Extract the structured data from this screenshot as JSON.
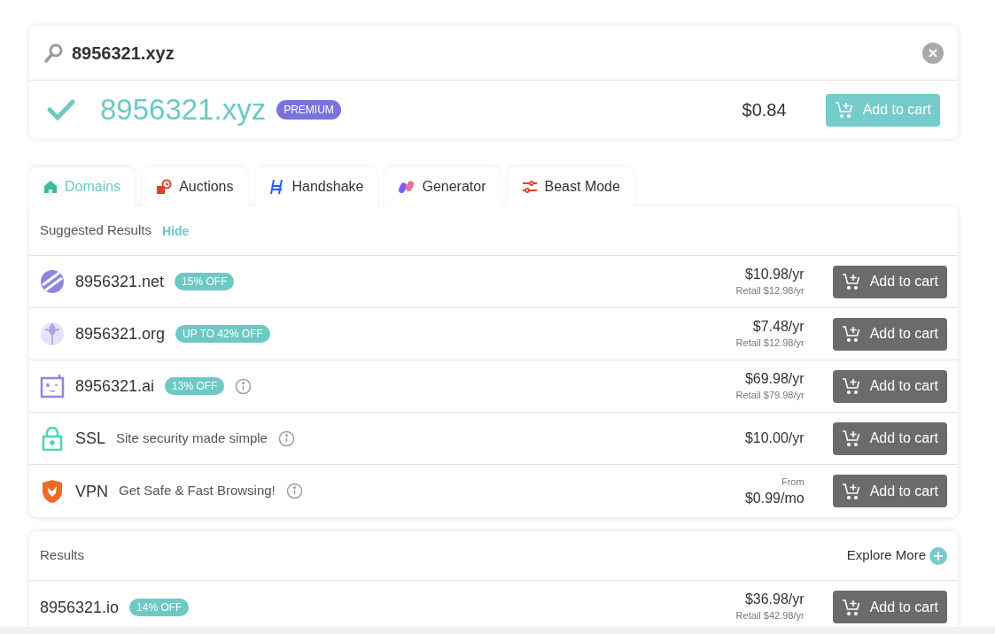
{
  "search": {
    "value": "8956321.xyz"
  },
  "top_result": {
    "domain": "8956321.xyz",
    "badge": "PREMIUM",
    "price": "$0.84",
    "button": "Add to cart"
  },
  "tabs": [
    {
      "label": "Domains",
      "selected": true
    },
    {
      "label": "Auctions",
      "selected": false
    },
    {
      "label": "Handshake",
      "selected": false
    },
    {
      "label": "Generator",
      "selected": false
    },
    {
      "label": "Beast Mode",
      "selected": false
    }
  ],
  "suggested": {
    "title": "Suggested Results",
    "hide_link": "Hide",
    "rows": [
      {
        "kind": "domain",
        "name": "8956321.net",
        "badge": "15% OFF",
        "info": false,
        "price": "$10.98/yr",
        "retail": "Retail $12.98/yr",
        "button": "Add to cart"
      },
      {
        "kind": "domain",
        "name": "8956321.org",
        "badge": "UP TO 42% OFF",
        "info": false,
        "price": "$7.48/yr",
        "retail": "Retail $12.98/yr",
        "button": "Add to cart"
      },
      {
        "kind": "domain",
        "name": "8956321.ai",
        "badge": "13% OFF",
        "info": true,
        "price": "$69.98/yr",
        "retail": "Retail $79.98/yr",
        "button": "Add to cart"
      },
      {
        "kind": "product",
        "name": "SSL",
        "description": "Site security made simple",
        "info": true,
        "price": "$10.00/yr",
        "button": "Add to cart"
      },
      {
        "kind": "product",
        "name": "VPN",
        "description": "Get Safe & Fast Browsing!",
        "info": true,
        "price_prefix": "From",
        "price": "$0.99/mo",
        "button": "Add to cart"
      }
    ]
  },
  "results": {
    "title": "Results",
    "explore_link": "Explore More",
    "rows": [
      {
        "name": "8956321.io",
        "badge": "14% OFF",
        "price": "$36.98/yr",
        "retail": "Retail $42.98/yr",
        "button": "Add to cart"
      }
    ]
  }
}
